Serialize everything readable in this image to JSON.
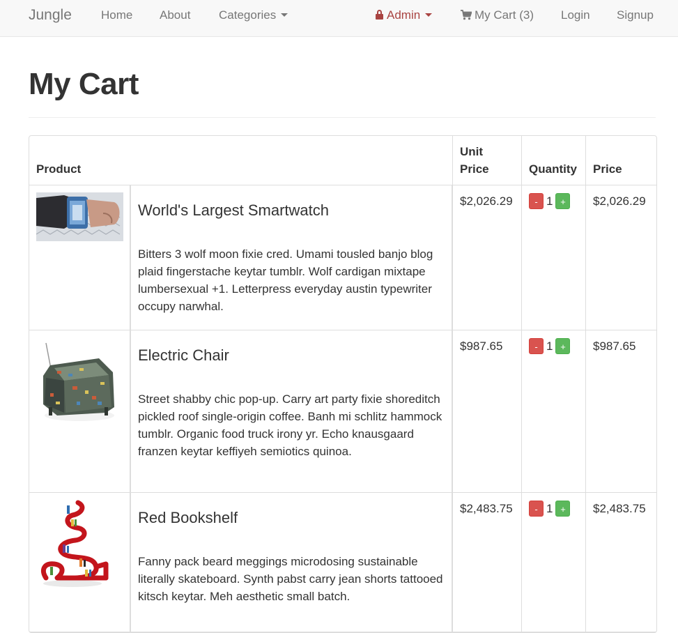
{
  "nav": {
    "brand": "Jungle",
    "home": "Home",
    "about": "About",
    "categories": "Categories",
    "admin": "Admin",
    "cart": "My Cart (3)",
    "login": "Login",
    "signup": "Signup",
    "admin_color": "#a94442"
  },
  "page": {
    "title": "My Cart"
  },
  "table": {
    "headers": {
      "product": "Product",
      "unit_price": "Unit Price",
      "quantity": "Quantity",
      "price": "Price"
    },
    "rows": [
      {
        "name": "World's Largest Smartwatch",
        "description": "Bitters 3 wolf moon fixie cred. Umami tousled banjo blog plaid fingerstache keytar tumblr. Wolf cardigan mixtape lumbersexual +1. Letterpress everyday austin typewriter occupy narwhal.",
        "unit_price": "$2,026.29",
        "quantity": "1",
        "price": "$2,026.29",
        "minus": "-",
        "plus": "+"
      },
      {
        "name": "Electric Chair",
        "description": "Street shabby chic pop-up. Carry art party fixie shoreditch pickled roof single-origin coffee. Banh mi schlitz hammock tumblr. Organic food truck irony yr. Echo knausgaard franzen keytar keffiyeh semiotics quinoa.",
        "unit_price": "$987.65",
        "quantity": "1",
        "price": "$987.65",
        "minus": "-",
        "plus": "+"
      },
      {
        "name": "Red Bookshelf",
        "description": "Fanny pack beard meggings microdosing sustainable literally skateboard. Synth pabst carry jean shorts tattooed kitsch keytar. Meh aesthetic small batch.",
        "unit_price": "$2,483.75",
        "quantity": "1",
        "price": "$2,483.75",
        "minus": "-",
        "plus": "+"
      }
    ]
  }
}
